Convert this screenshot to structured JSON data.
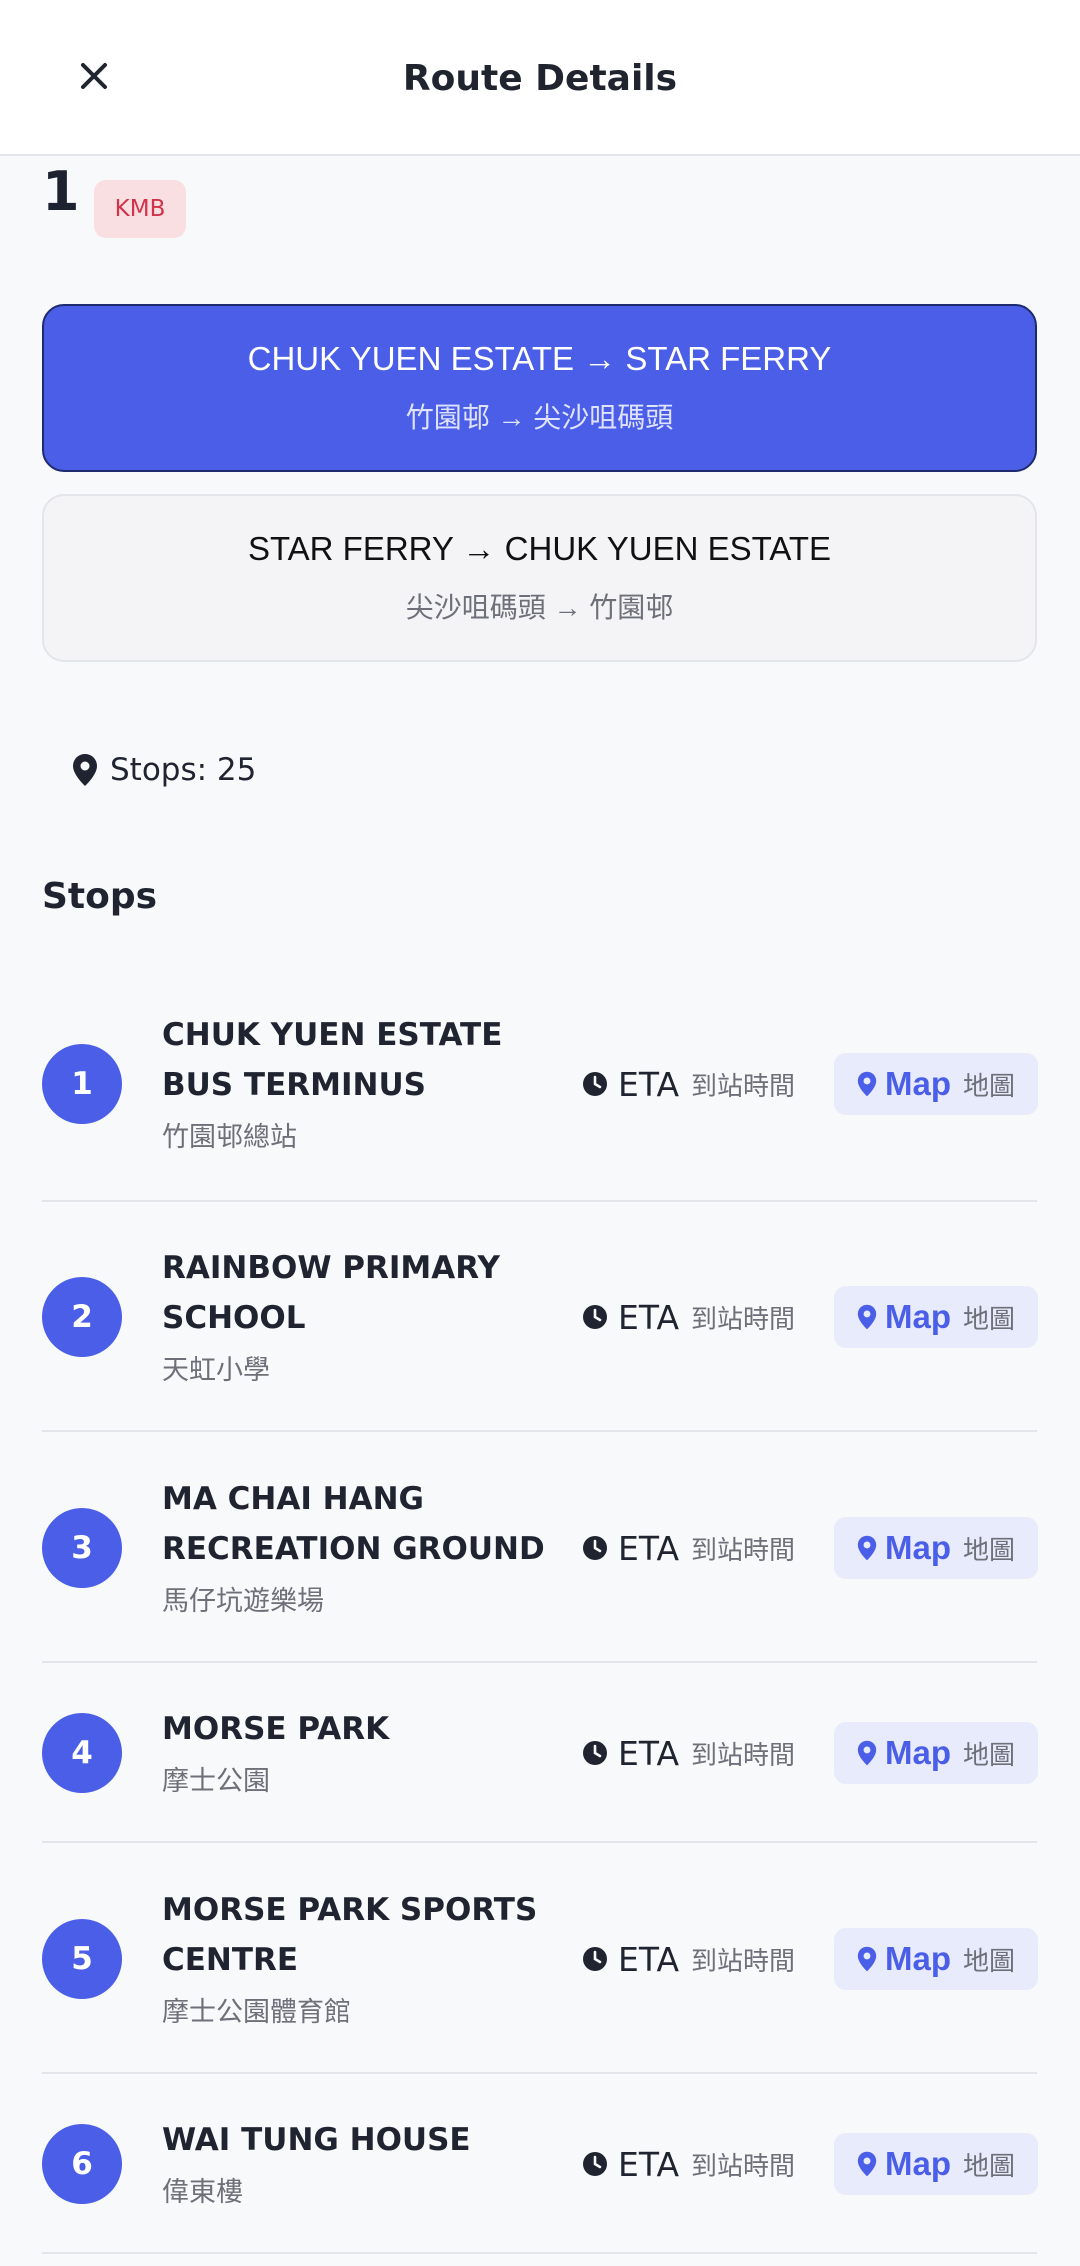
{
  "header": {
    "title": "Route Details",
    "close_icon": "close-icon"
  },
  "route": {
    "number": "1",
    "operator": "KMB"
  },
  "directions": [
    {
      "en": "CHUK YUEN ESTATE → STAR FERRY",
      "zh": "竹園邨 → 尖沙咀碼頭",
      "active": true
    },
    {
      "en": "STAR FERRY → CHUK YUEN ESTATE",
      "zh": "尖沙咀碼頭 → 竹園邨",
      "active": false
    }
  ],
  "summary": {
    "stops_label": "Stops: 25",
    "icon": "map-pin-icon"
  },
  "stops_section": {
    "heading": "Stops",
    "eta_label": "ETA",
    "eta_label_zh": "到站時間",
    "map_label": "Map",
    "map_label_zh": "地圖",
    "items": [
      {
        "num": "1",
        "en": "CHUK YUEN ESTATE BUS TERMINUS",
        "zh": "竹園邨總站"
      },
      {
        "num": "2",
        "en": "RAINBOW PRIMARY SCHOOL",
        "zh": "天虹小學"
      },
      {
        "num": "3",
        "en": "MA CHAI HANG RECREATION GROUND",
        "zh": "馬仔坑遊樂場"
      },
      {
        "num": "4",
        "en": "MORSE PARK",
        "zh": "摩士公園"
      },
      {
        "num": "5",
        "en": "MORSE PARK SPORTS CENTRE",
        "zh": "摩士公園體育館"
      },
      {
        "num": "6",
        "en": "WAI TUNG HOUSE",
        "zh": "偉東樓"
      }
    ]
  },
  "colors": {
    "accent": "#4a5ee8",
    "badge_bg": "#f9dfe2",
    "badge_text": "#d1334a"
  }
}
